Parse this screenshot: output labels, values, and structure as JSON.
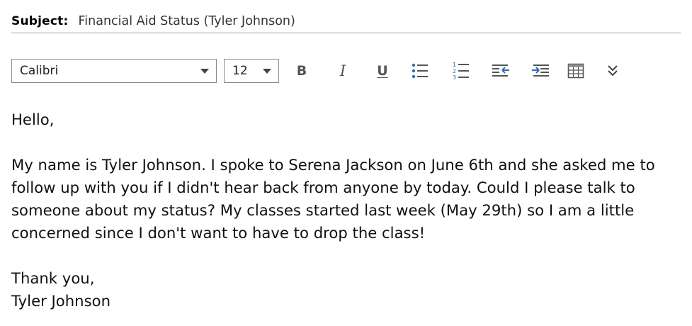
{
  "subject": {
    "label": "Subject:",
    "value": "Financial Aid Status (Tyler Johnson)"
  },
  "toolbar": {
    "font_family": "Calibri",
    "font_size": "12",
    "bold_label": "B",
    "italic_label": "I",
    "underline_label": "U",
    "icons": [
      "bullet-list-icon",
      "numbered-list-icon",
      "decrease-indent-icon",
      "increase-indent-icon",
      "table-icon",
      "more-options-icon"
    ],
    "accent_color": "#2b6cb0"
  },
  "body": {
    "greeting": "Hello,",
    "paragraph_lines": [
      "My name is Tyler Johnson. I spoke to Serena Jackson on June 6th and she asked me to",
      "follow up with you if I didn't hear back from anyone by today. Could I please talk to",
      "someone about my status? My classes started last week (May 29th) so I am a little",
      "concerned since I don't want to have to drop the class!"
    ],
    "closing": "Thank you,",
    "signature": "Tyler Johnson"
  }
}
